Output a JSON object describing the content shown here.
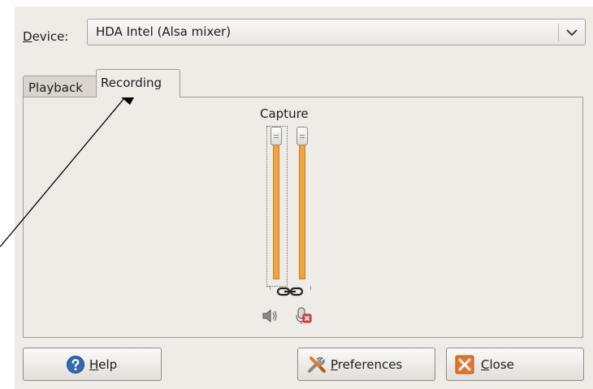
{
  "device": {
    "label": "Device:",
    "value": "HDA Intel (Alsa mixer)"
  },
  "tabs": [
    {
      "label": "Playback",
      "active": false
    },
    {
      "label": "Recording",
      "active": true
    }
  ],
  "capture": {
    "title": "Capture",
    "locked": true
  },
  "buttons": {
    "help": "Help",
    "preferences": "Preferences",
    "close": "Close"
  },
  "icons": {
    "combo_arrow": "chevron-down-icon",
    "link": "chain-link-icon",
    "speaker": "speaker-icon",
    "record": "microphone-record-icon",
    "help": "help-icon",
    "preferences": "tools-icon",
    "close": "close-icon"
  },
  "colors": {
    "slider_fill": "#f0a43c",
    "close_icon": "#e8742a",
    "help_icon": "#2f6ab3"
  }
}
